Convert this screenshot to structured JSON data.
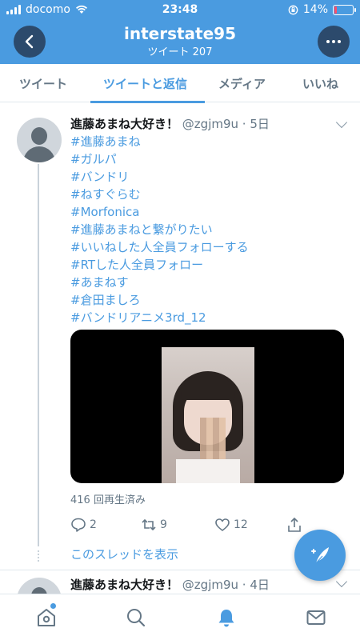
{
  "status_bar": {
    "carrier": "docomo",
    "time": "23:48",
    "battery": "14%",
    "battery_level": 0.14
  },
  "header": {
    "title": "interstate95",
    "subtitle": "ツイート 207"
  },
  "tabs": [
    {
      "label": "ツイート",
      "active": false
    },
    {
      "label": "ツイートと返信",
      "active": true
    },
    {
      "label": "メディア",
      "active": false
    },
    {
      "label": "いいね",
      "active": false
    }
  ],
  "tweet": {
    "name": "進藤あまね大好き！",
    "handle": "@zgjm9u",
    "time": "5日",
    "hashtags": [
      "#進藤あまね",
      "#ガルパ",
      "#バンドリ",
      "#ねすぐらむ",
      "#Morfonica",
      "#進藤あまねと繋がりたい",
      "#いいねした人全員フォローする",
      "#RTした人全員フォロー",
      "#あまねす",
      "#倉田ましろ",
      "#バンドリアニメ3rd_12"
    ],
    "view_count": "416 回再生済み",
    "replies": "2",
    "retweets": "9",
    "likes": "12",
    "show_thread": "このスレッドを表示"
  },
  "tweet2": {
    "name": "進藤あまね大好き！",
    "handle": "@zgjm9u",
    "time": "4日"
  },
  "colors": {
    "accent": "#4a9be0",
    "header_button": "#2c4a6c",
    "muted": "#657786"
  },
  "bottom_nav": [
    "home-icon",
    "search-icon",
    "notifications-icon",
    "messages-icon"
  ]
}
